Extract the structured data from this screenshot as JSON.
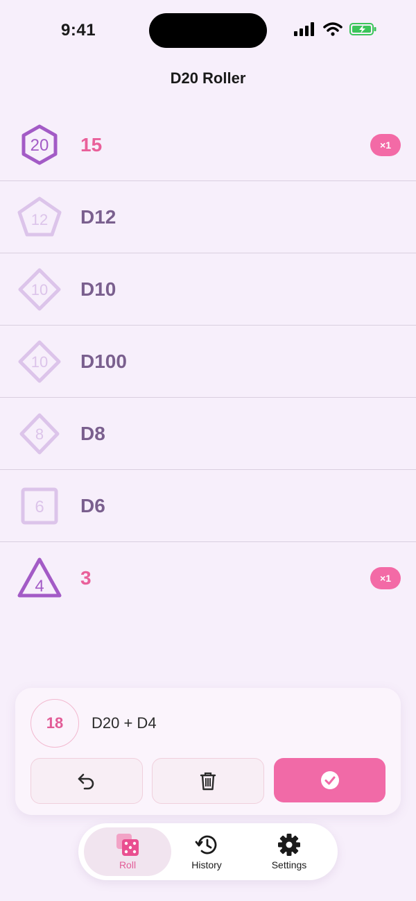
{
  "status": {
    "time": "9:41"
  },
  "header": {
    "title": "D20 Roller"
  },
  "dice": [
    {
      "icon": "d20-icon",
      "number": "20",
      "label": "15",
      "active": true,
      "badge": "×1"
    },
    {
      "icon": "d12-icon",
      "number": "12",
      "label": "D12",
      "active": false,
      "badge": ""
    },
    {
      "icon": "d10-icon",
      "number": "10",
      "label": "D10",
      "active": false,
      "badge": ""
    },
    {
      "icon": "d100-icon",
      "number": "10",
      "label": "D100",
      "active": false,
      "badge": ""
    },
    {
      "icon": "d8-icon",
      "number": "8",
      "label": "D8",
      "active": false,
      "badge": ""
    },
    {
      "icon": "d6-icon",
      "number": "6",
      "label": "D6",
      "active": false,
      "badge": ""
    },
    {
      "icon": "d4-icon",
      "number": "4",
      "label": "3",
      "active": true,
      "badge": "×1"
    }
  ],
  "tray": {
    "total": "18",
    "formula": "D20 + D4",
    "buttons": {
      "undo": "undo-icon",
      "delete": "trash-icon",
      "confirm": "checkmark-icon"
    }
  },
  "tabs": [
    {
      "label": "Roll",
      "icon": "dice-icon",
      "selected": true
    },
    {
      "label": "History",
      "icon": "history-icon",
      "selected": false
    },
    {
      "label": "Settings",
      "icon": "gear-icon",
      "selected": false
    }
  ],
  "colors": {
    "accent": "#f16aa7",
    "die_active": "#a35bc6",
    "die_inactive": "#dcc4ea",
    "label_inactive": "#7a5f8e"
  }
}
